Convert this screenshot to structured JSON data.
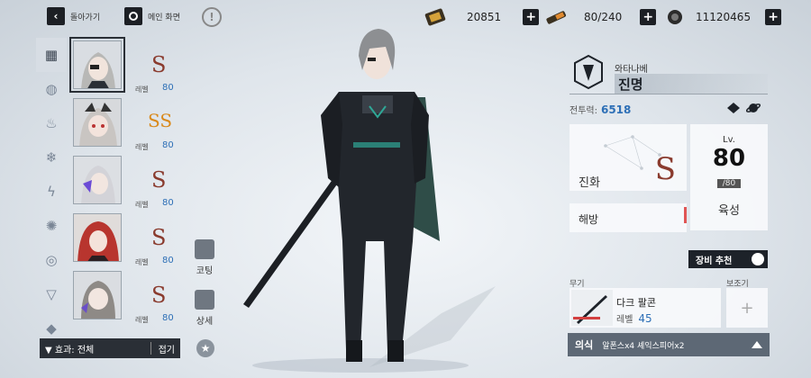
{
  "topbar": {
    "back_label": "돌아가기",
    "home_label": "메인 화면",
    "resources": [
      {
        "icon": "ticket-icon",
        "value": "20851"
      },
      {
        "icon": "stamina-icon",
        "value": "80/240"
      },
      {
        "icon": "gold-coin-icon",
        "value": "11120465"
      }
    ]
  },
  "filters": [
    "all-grid-icon",
    "saturn-icon",
    "flame-icon",
    "snowflake-icon",
    "lightning-icon",
    "swirl-icon",
    "ring-icon",
    "arrow-down-icon",
    "diamond-icon"
  ],
  "characters": [
    {
      "grade": "S",
      "level_label": "레벨",
      "level": "80",
      "hair": "#b8b8b6"
    },
    {
      "grade": "SS",
      "level_label": "레벨",
      "level": "80",
      "hair": "#c9c5c2"
    },
    {
      "grade": "S",
      "level_label": "레벨",
      "level": "80",
      "hair": "#d3d3d8"
    },
    {
      "grade": "S",
      "level_label": "레벨",
      "level": "80",
      "hair": "#b8352e"
    },
    {
      "grade": "S",
      "level_label": "레벨",
      "level": "80",
      "hair": "#8e8a86"
    }
  ],
  "side": {
    "costume": "코팅",
    "detail": "상세"
  },
  "effect": {
    "label": "▼ 효과: 전체",
    "fold": "접기"
  },
  "panel": {
    "name_small": "와타나베",
    "name_big": "진명",
    "power_label": "전투력:",
    "power_value": "6518",
    "evolution_label": "진화",
    "evolution_grade": "S",
    "level_title": "Lv.",
    "level_value": "80",
    "level_max": "/80",
    "grow_label": "육성",
    "release_label": "해방",
    "recommend_label": "장비 추천",
    "weapon_label": "무기",
    "sub_label": "보조기",
    "weapon_name": "다크 팔콘",
    "weapon_level_label": "레벨",
    "weapon_level": "45",
    "ritual_label": "의식",
    "ritual_text": "알폰스x4 셰익스피어x2"
  },
  "colors": {
    "accent": "#2d6fb6",
    "grade": "#8a3b2e",
    "dark": "#1d2229",
    "teal": "#2fa796"
  }
}
